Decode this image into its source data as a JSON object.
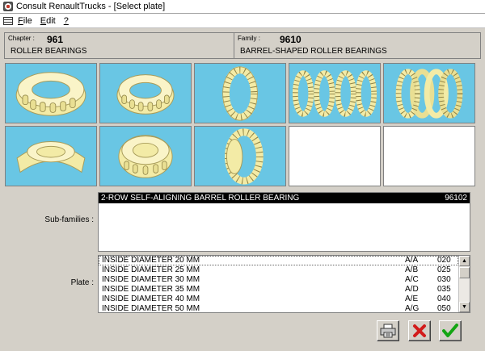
{
  "window": {
    "title": "Consult RenaultTrucks - [Select plate]"
  },
  "menu": [
    {
      "label": "File",
      "accel": "F",
      "rest": "ile"
    },
    {
      "label": "Edit",
      "accel": "E",
      "rest": "dit"
    },
    {
      "label": "?",
      "accel": "?",
      "rest": ""
    }
  ],
  "chapter": {
    "caption": "Chapter :",
    "code": "961",
    "name": "ROLLER BEARINGS"
  },
  "family": {
    "caption": "Family :",
    "code": "9610",
    "name": "BARREL-SHAPED ROLLER BEARINGS"
  },
  "plates_grid": {
    "thumbnails": [
      {
        "icon": "barrel-bearing-perspective-icon",
        "filled": true
      },
      {
        "icon": "barrel-bearing-cage-icon",
        "filled": true
      },
      {
        "icon": "barrel-roller-ring-icon",
        "filled": true
      },
      {
        "icon": "double-roller-rings-icon",
        "filled": true
      },
      {
        "icon": "overlapping-roller-rings-icon",
        "filled": true
      },
      {
        "icon": "bearing-housing-icon",
        "filled": true
      },
      {
        "icon": "bearing-with-cover-icon",
        "filled": true
      },
      {
        "icon": "tilted-roller-ring-icon",
        "filled": true
      },
      {
        "icon": "",
        "filled": false
      },
      {
        "icon": "",
        "filled": false
      }
    ]
  },
  "subfamilies": {
    "label": "Sub-families :",
    "items": [
      {
        "description": "2-ROW SELF-ALIGNING BARREL ROLLER BEARING",
        "code": "96102",
        "selected": true
      }
    ]
  },
  "plate": {
    "label": "Plate :",
    "rows": [
      {
        "description": "INSIDE DIAMETER 20 MM",
        "code": "A/A",
        "number": "020"
      },
      {
        "description": "INSIDE DIAMETER  25 MM",
        "code": "A/B",
        "number": "025"
      },
      {
        "description": "INSIDE DIAMETER 30 MM",
        "code": "A/C",
        "number": "030"
      },
      {
        "description": "INSIDE DIAMETER  35 MM",
        "code": "A/D",
        "number": "035"
      },
      {
        "description": "INSIDE DIAMETER  40 MM",
        "code": "A/E",
        "number": "040"
      },
      {
        "description": "INSIDE DIAMETER  50 MM",
        "code": "A/G",
        "number": "050"
      }
    ]
  },
  "buttons": {
    "print": {
      "icon": "printer-icon"
    },
    "cancel": {
      "icon": "red-x-icon"
    },
    "ok": {
      "icon": "green-check-icon"
    }
  },
  "colors": {
    "thumbnail_bg": "#69c6e4",
    "bearing": "#f3eba6",
    "cancel": "#d21b1b",
    "ok": "#13a513"
  }
}
